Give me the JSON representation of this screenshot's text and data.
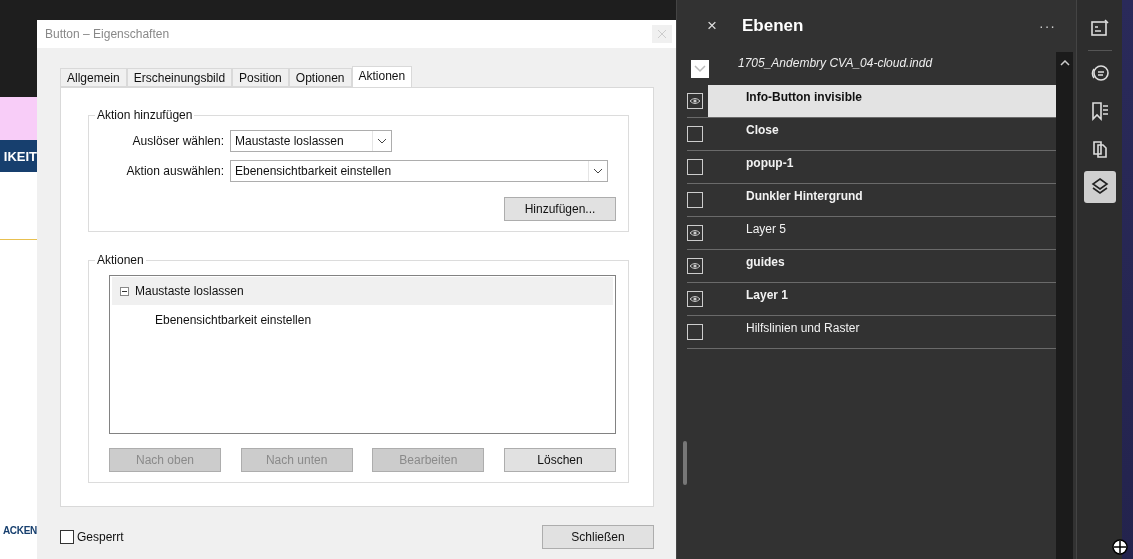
{
  "background_document": {
    "texts": [
      "IKEIT",
      "ACKEN"
    ]
  },
  "dialog": {
    "title": "Button – Eigenschaften",
    "tabs": [
      {
        "label": "Allgemein",
        "selected": false
      },
      {
        "label": "Erscheinungsbild",
        "selected": false
      },
      {
        "label": "Position",
        "selected": false
      },
      {
        "label": "Optionen",
        "selected": false
      },
      {
        "label": "Aktionen",
        "selected": true
      }
    ],
    "add_group": {
      "title": "Aktion hinzufügen",
      "fields": [
        {
          "label": "Auslöser wählen:",
          "value": "Maustaste loslassen",
          "wide": false
        },
        {
          "label": "Aktion auswählen:",
          "value": "Ebenensichtbarkeit einstellen",
          "wide": true
        }
      ],
      "add_button": "Hinzufügen..."
    },
    "actions_group": {
      "title": "Aktionen",
      "tree": [
        {
          "label": "Maustaste loslassen",
          "expanded": true,
          "children": [
            {
              "label": "Ebenensichtbarkeit einstellen"
            }
          ]
        }
      ],
      "buttons": [
        {
          "label": "Nach oben",
          "disabled": true
        },
        {
          "label": "Nach unten",
          "disabled": true
        },
        {
          "label": "Bearbeiten",
          "disabled": true
        },
        {
          "label": "Löschen",
          "disabled": false
        }
      ]
    },
    "locked": {
      "label": "Gesperrt",
      "checked": false
    },
    "close_button": "Schließen"
  },
  "layers_panel": {
    "close": "×",
    "title": "Ebenen",
    "more": "···",
    "document": "1705_Andembry CVA_04-cloud.indd",
    "layers": [
      {
        "name": "Info-Button invisible",
        "visible": true,
        "bold": true,
        "selected": true
      },
      {
        "name": "Close",
        "visible": false,
        "bold": true,
        "selected": false
      },
      {
        "name": "popup-1",
        "visible": false,
        "bold": true,
        "selected": false
      },
      {
        "name": "Dunkler Hintergrund",
        "visible": false,
        "bold": true,
        "selected": false
      },
      {
        "name": "Layer 5",
        "visible": true,
        "bold": false,
        "selected": false
      },
      {
        "name": "guides",
        "visible": true,
        "bold": true,
        "selected": false
      },
      {
        "name": "Layer 1",
        "visible": true,
        "bold": true,
        "selected": false
      },
      {
        "name": "Hilfslinien und Raster",
        "visible": false,
        "bold": false,
        "selected": false
      }
    ]
  },
  "tool_strip": [
    {
      "kind": "form",
      "selected": false
    },
    {
      "kind": "comment",
      "selected": false
    },
    {
      "kind": "bookmark",
      "selected": false
    },
    {
      "kind": "pages",
      "selected": false
    },
    {
      "kind": "layers",
      "selected": true
    }
  ]
}
